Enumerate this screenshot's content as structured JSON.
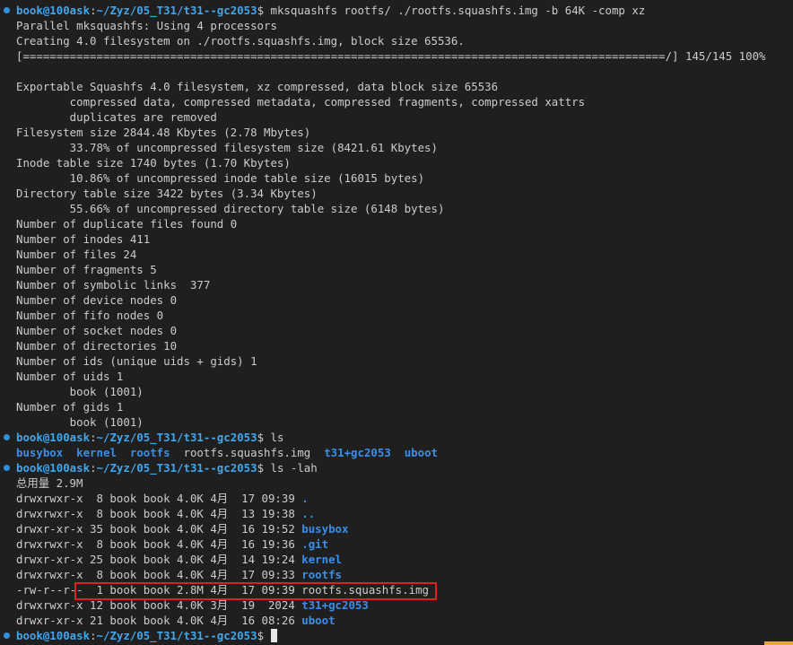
{
  "prompt": {
    "user": "book@100ask",
    "sep": ":",
    "path": "~/Zyz/05_T31/t31--gc2053",
    "symbol": "$ "
  },
  "cmd1": "mksquashfs rootfs/ ./rootfs.squashfs.img -b 64K -comp xz",
  "out1": [
    "Parallel mksquashfs: Using 4 processors",
    "Creating 4.0 filesystem on ./rootfs.squashfs.img, block size 65536.",
    "[================================================================================================/] 145/145 100%",
    "",
    "Exportable Squashfs 4.0 filesystem, xz compressed, data block size 65536",
    "        compressed data, compressed metadata, compressed fragments, compressed xattrs",
    "        duplicates are removed",
    "Filesystem size 2844.48 Kbytes (2.78 Mbytes)",
    "        33.78% of uncompressed filesystem size (8421.61 Kbytes)",
    "Inode table size 1740 bytes (1.70 Kbytes)",
    "        10.86% of uncompressed inode table size (16015 bytes)",
    "Directory table size 3422 bytes (3.34 Kbytes)",
    "        55.66% of uncompressed directory table size (6148 bytes)",
    "Number of duplicate files found 0",
    "Number of inodes 411",
    "Number of files 24",
    "Number of fragments 5",
    "Number of symbolic links  377",
    "Number of device nodes 0",
    "Number of fifo nodes 0",
    "Number of socket nodes 0",
    "Number of directories 10",
    "Number of ids (unique uids + gids) 1",
    "Number of uids 1",
    "        book (1001)",
    "Number of gids 1",
    "        book (1001)"
  ],
  "cmd2": "ls",
  "ls_items": [
    {
      "name": "busybox",
      "kind": "dir",
      "sep": "  "
    },
    {
      "name": "kernel",
      "kind": "dir",
      "sep": "  "
    },
    {
      "name": "rootfs",
      "kind": "dir",
      "sep": "  "
    },
    {
      "name": "rootfs.squashfs.img",
      "kind": "file",
      "sep": "  "
    },
    {
      "name": "t31+gc2053",
      "kind": "dir",
      "sep": "  "
    },
    {
      "name": "uboot",
      "kind": "dir",
      "sep": ""
    }
  ],
  "cmd3": "ls -lah",
  "total": "总用量 2.9M",
  "lah": [
    {
      "prefix": "drwxrwxr-x  8 book book 4.0K 4月  17 09:39 ",
      "name": ".",
      "kind": "dir"
    },
    {
      "prefix": "drwxrwxr-x  8 book book 4.0K 4月  13 19:38 ",
      "name": "..",
      "kind": "dir"
    },
    {
      "prefix": "drwxr-xr-x 35 book book 4.0K 4月  16 19:52 ",
      "name": "busybox",
      "kind": "dir"
    },
    {
      "prefix": "drwxrwxr-x  8 book book 4.0K 4月  16 19:36 ",
      "name": ".git",
      "kind": "dir"
    },
    {
      "prefix": "drwxr-xr-x 25 book book 4.0K 4月  14 19:24 ",
      "name": "kernel",
      "kind": "dir"
    },
    {
      "prefix": "drwxrwxr-x  8 book book 4.0K 4月  17 09:33 ",
      "name": "rootfs",
      "kind": "dir"
    },
    {
      "prefix": "-rw-r--r--  1 book book 2.8M 4月  17 09:39 ",
      "name": "rootfs.squashfs.img",
      "kind": "file"
    },
    {
      "prefix": "drwxrwxr-x 12 book book 4.0K 3月  19  2024 ",
      "name": "t31+gc2053",
      "kind": "dir"
    },
    {
      "prefix": "drwxr-xr-x 21 book book 4.0K 4月  16 08:26 ",
      "name": "uboot",
      "kind": "dir"
    }
  ],
  "cmd4": "",
  "colors": {
    "background": "#1f1f1f",
    "text": "#cccccc",
    "prompt": "#3fa7f0",
    "directory": "#3b8eea",
    "highlight": "#e02020"
  }
}
